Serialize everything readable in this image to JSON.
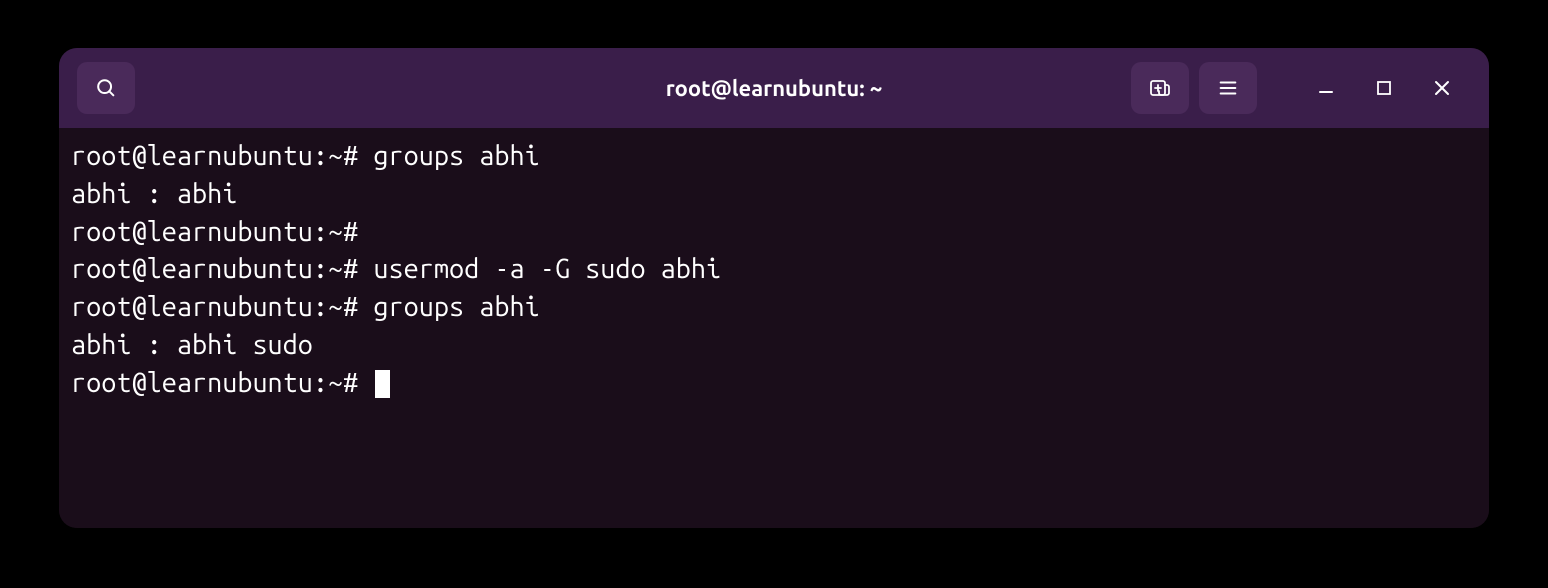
{
  "window": {
    "title": "root@learnubuntu: ~"
  },
  "terminal": {
    "lines": [
      "root@learnubuntu:~# groups abhi",
      "abhi : abhi",
      "root@learnubuntu:~# ",
      "root@learnubuntu:~# usermod -a -G sudo abhi",
      "root@learnubuntu:~# groups abhi",
      "abhi : abhi sudo",
      "root@learnubuntu:~# "
    ]
  }
}
